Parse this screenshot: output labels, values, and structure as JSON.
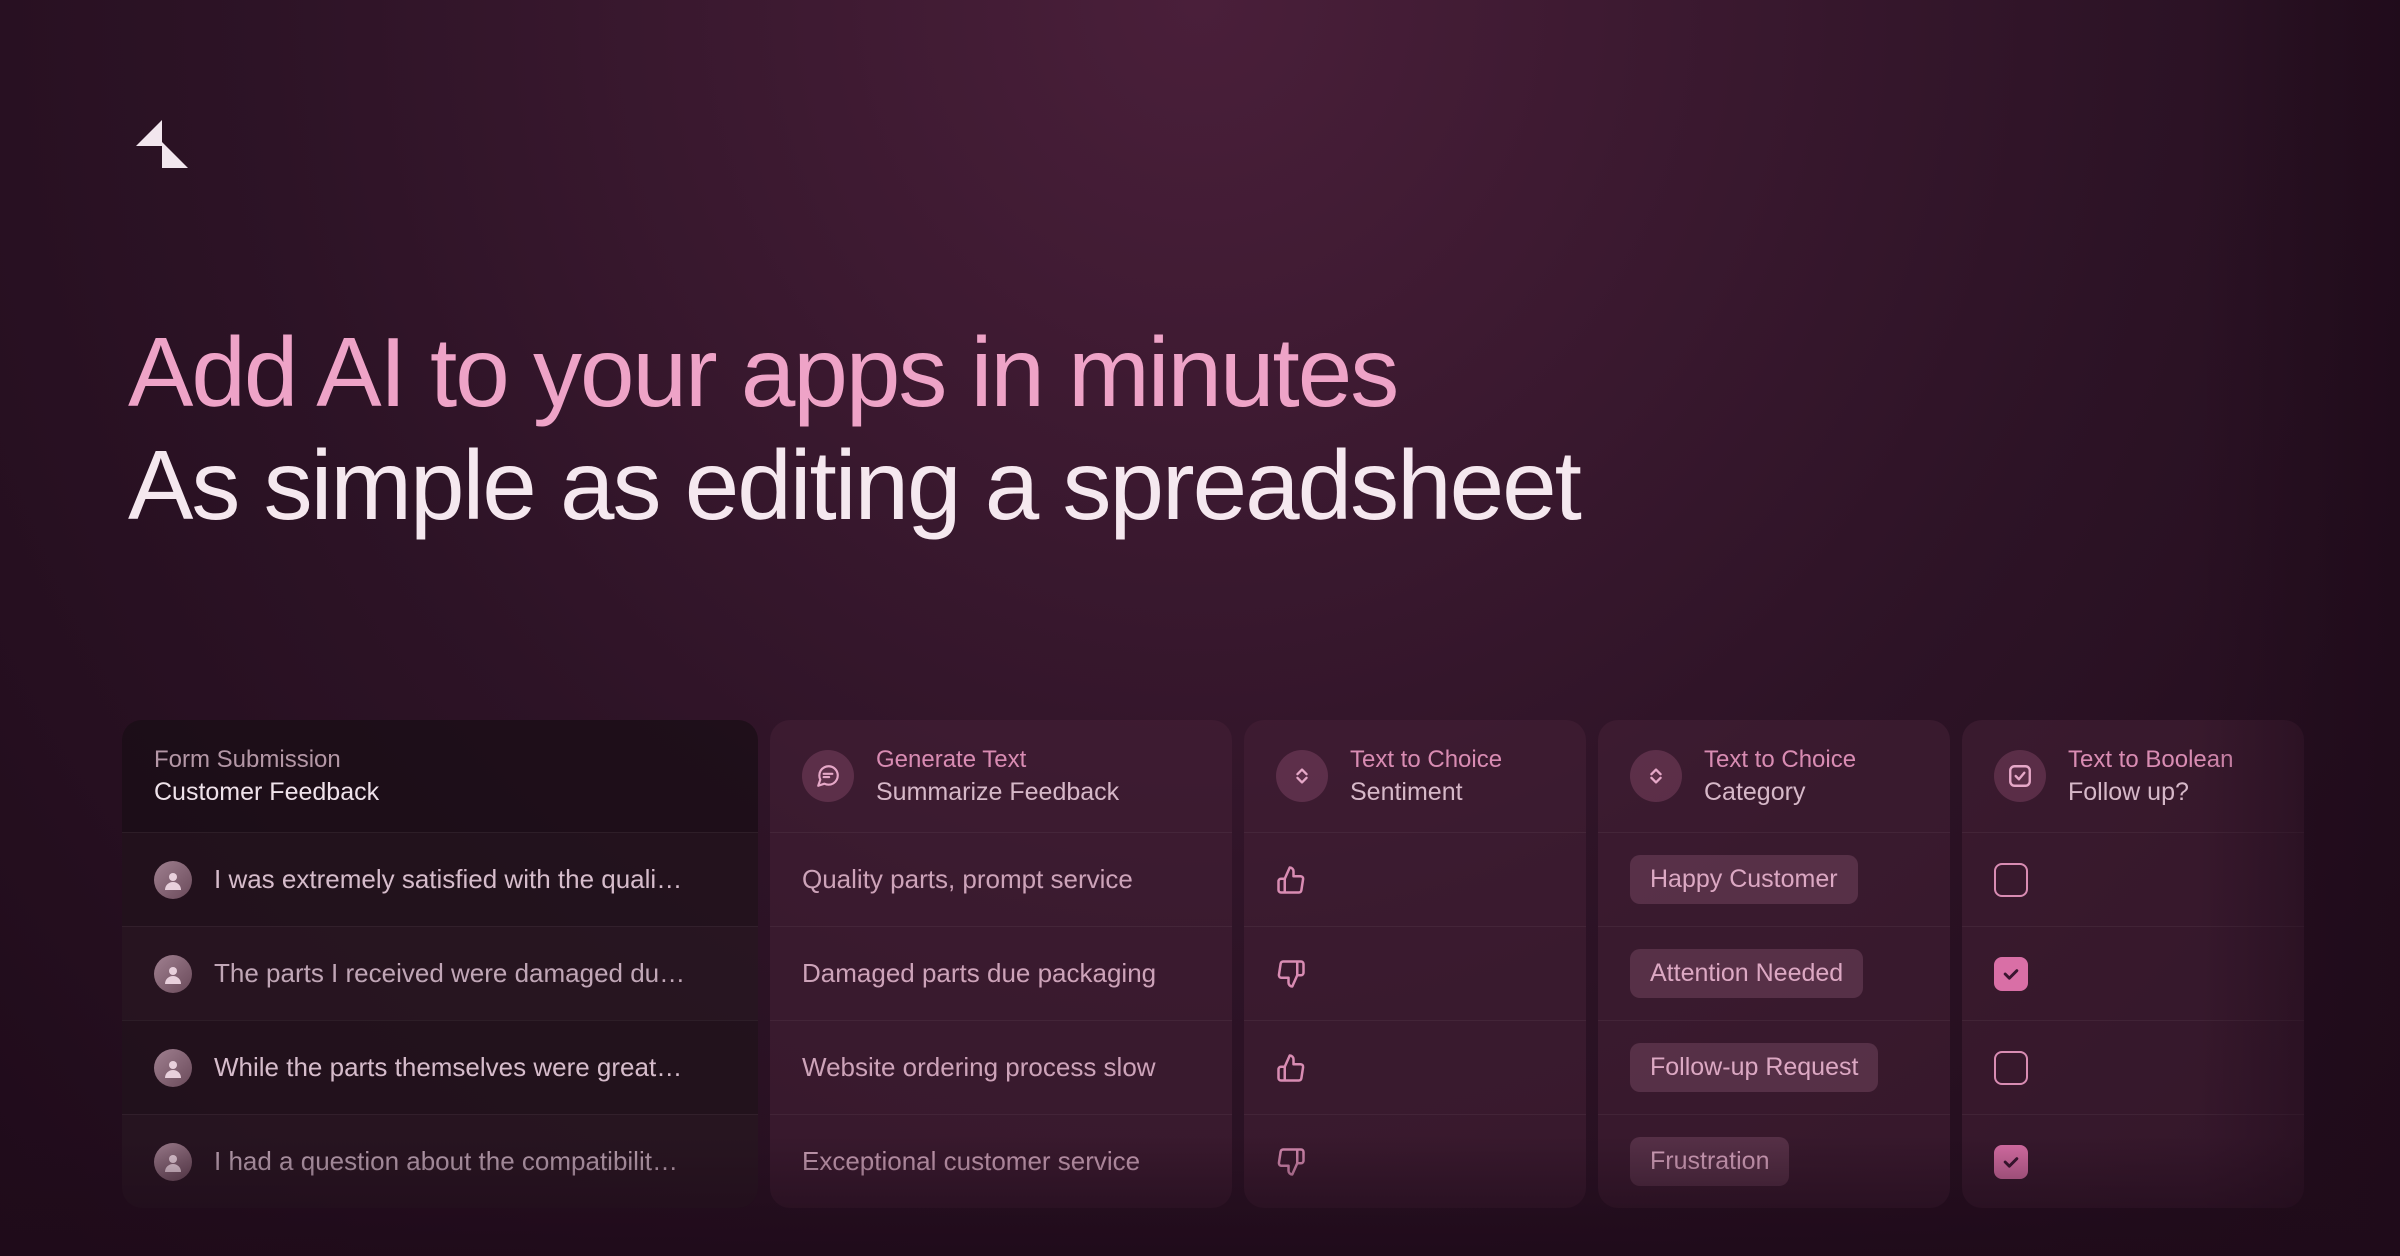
{
  "headline": {
    "line1": "Add AI to your apps in minutes",
    "line2": "As simple as editing a spreadsheet"
  },
  "columns": {
    "feedback": {
      "type": "Form Submission",
      "name": "Customer Feedback"
    },
    "summary": {
      "type": "Generate Text",
      "name": "Summarize Feedback"
    },
    "sentiment": {
      "type": "Text to Choice",
      "name": "Sentiment"
    },
    "category": {
      "type": "Text to Choice",
      "name": "Category"
    },
    "follow": {
      "type": "Text to Boolean",
      "name": "Follow up?"
    }
  },
  "rows": [
    {
      "feedback": "I was extremely satisfied with the quali…",
      "summary": "Quality parts, prompt service",
      "sentiment": "up",
      "category": "Happy Customer",
      "follow": false
    },
    {
      "feedback": "The parts I received were damaged du…",
      "summary": "Damaged parts due packaging",
      "sentiment": "down",
      "category": "Attention Needed",
      "follow": true
    },
    {
      "feedback": "While the parts themselves were great…",
      "summary": "Website ordering process slow",
      "sentiment": "up",
      "category": "Follow-up Request",
      "follow": false
    },
    {
      "feedback": "I had a question about the compatibilit…",
      "summary": "Exceptional customer service",
      "sentiment": "down",
      "category": "Frustration",
      "follow": true
    }
  ]
}
